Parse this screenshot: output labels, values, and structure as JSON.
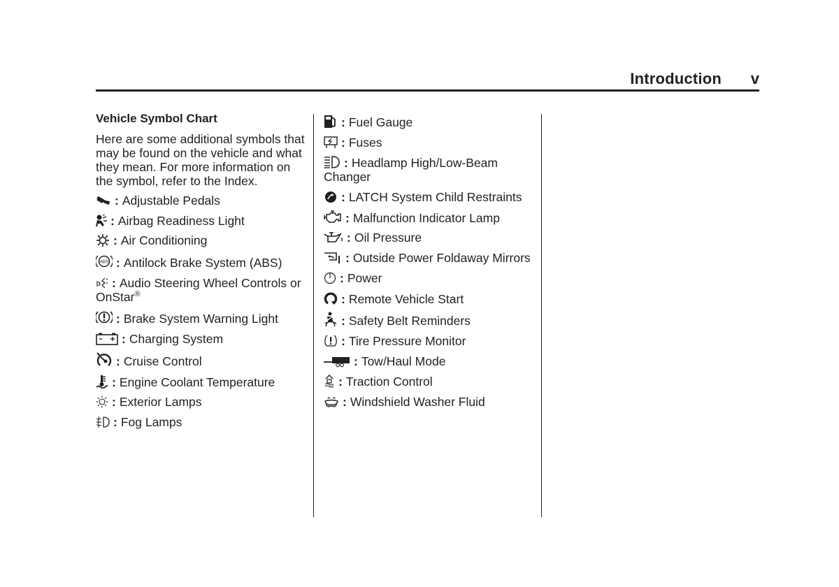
{
  "header": {
    "title": "Introduction",
    "page": "v"
  },
  "left_column": {
    "section_title": "Vehicle Symbol Chart",
    "intro": "Here are some additional symbols that may be found on the vehicle and what they mean. For more information on the symbol, refer to the Index.",
    "separator": ":",
    "entries": [
      {
        "icon": "adjustable-pedals-icon",
        "label": "Adjustable Pedals"
      },
      {
        "icon": "airbag-icon",
        "label": "Airbag Readiness Light"
      },
      {
        "icon": "air-conditioning-icon",
        "label": "Air Conditioning"
      },
      {
        "icon": "abs-icon",
        "label": "Antilock Brake System (ABS)"
      },
      {
        "icon": "audio-steering-icon",
        "label": "Audio Steering Wheel Controls or OnStar",
        "superscript": "®"
      },
      {
        "icon": "brake-warning-icon",
        "label": "Brake System Warning Light"
      },
      {
        "icon": "battery-icon",
        "label": "Charging System"
      },
      {
        "icon": "cruise-control-icon",
        "label": "Cruise Control"
      },
      {
        "icon": "coolant-temperature-icon",
        "label": "Engine Coolant Temperature"
      },
      {
        "icon": "exterior-lamp-icon",
        "label": "Exterior Lamps"
      },
      {
        "icon": "fog-lamp-icon",
        "label": "Fog Lamps"
      }
    ]
  },
  "middle_column": {
    "separator": ":",
    "entries": [
      {
        "icon": "fuel-gauge-icon",
        "label": "Fuel Gauge"
      },
      {
        "icon": "fuse-icon",
        "label": "Fuses"
      },
      {
        "icon": "headlamp-beam-icon",
        "label": "Headlamp High/Low-Beam Changer"
      },
      {
        "icon": "latch-child-seat-icon",
        "label": "LATCH System Child Restraints"
      },
      {
        "icon": "check-engine-icon",
        "label": "Malfunction Indicator Lamp"
      },
      {
        "icon": "oil-pressure-icon",
        "label": "Oil Pressure"
      },
      {
        "icon": "folding-mirror-icon",
        "label": "Outside Power Foldaway Mirrors"
      },
      {
        "icon": "power-icon",
        "label": "Power"
      },
      {
        "icon": "remote-start-icon",
        "label": "Remote Vehicle Start"
      },
      {
        "icon": "seat-belt-icon",
        "label": "Safety Belt Reminders"
      },
      {
        "icon": "tire-pressure-icon",
        "label": "Tire Pressure Monitor"
      },
      {
        "icon": "tow-haul-icon",
        "label": "Tow/Haul Mode"
      },
      {
        "icon": "traction-control-icon",
        "label": "Traction Control"
      },
      {
        "icon": "washer-fluid-icon",
        "label": "Windshield Washer Fluid"
      }
    ]
  }
}
